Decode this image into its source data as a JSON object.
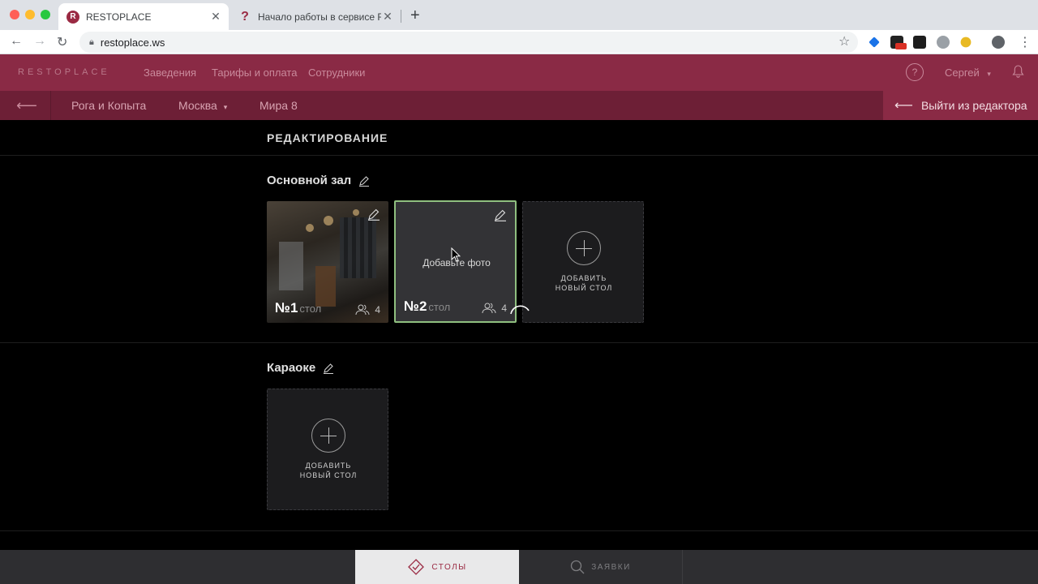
{
  "browser": {
    "tabs": [
      {
        "title": "RESTOPLACE",
        "favicon": "restoplace-icon",
        "active": true
      },
      {
        "title": "Начало работы в сервисе Re",
        "favicon": "question-icon",
        "active": false
      }
    ],
    "close_glyph": "✕",
    "new_tab_glyph": "+",
    "url": "restoplace.ws"
  },
  "app": {
    "logo": "RESTOPLACE",
    "nav": [
      "Заведения",
      "Тарифы и оплата",
      "Сотрудники"
    ],
    "help_glyph": "?",
    "user_name": "Сергей",
    "breadcrumbs": {
      "restaurant": "Рога и Копыта",
      "city": "Москва",
      "address": "Мира 8"
    },
    "exit_label": "Выйти из редактора"
  },
  "page": {
    "title": "РЕДАКТИРОВАНИЕ",
    "halls": [
      {
        "name": "Основной зал",
        "tables": [
          {
            "number": "№1",
            "suffix": "стол",
            "seats": "4",
            "has_photo": true
          },
          {
            "number": "№2",
            "suffix": "стол",
            "seats": "4",
            "has_photo": false,
            "add_photo_label": "Добавьте фото"
          }
        ],
        "add_table_label_line1": "ДОБАВИТЬ",
        "add_table_label_line2": "НОВЫЙ СТОЛ"
      },
      {
        "name": "Караоке",
        "tables": [],
        "add_table_label_line1": "ДОБАВИТЬ",
        "add_table_label_line2": "НОВЫЙ СТОЛ"
      }
    ]
  },
  "bottom_tabs": [
    {
      "label": "СТОЛЫ",
      "icon": "tables-icon",
      "active": true
    },
    {
      "label": "ЗАЯВКИ",
      "icon": "search-icon",
      "active": false
    }
  ],
  "colors": {
    "brand": "#8a2a45",
    "brand_dark": "#6d1f36",
    "selected_border": "#8fbf7f"
  }
}
